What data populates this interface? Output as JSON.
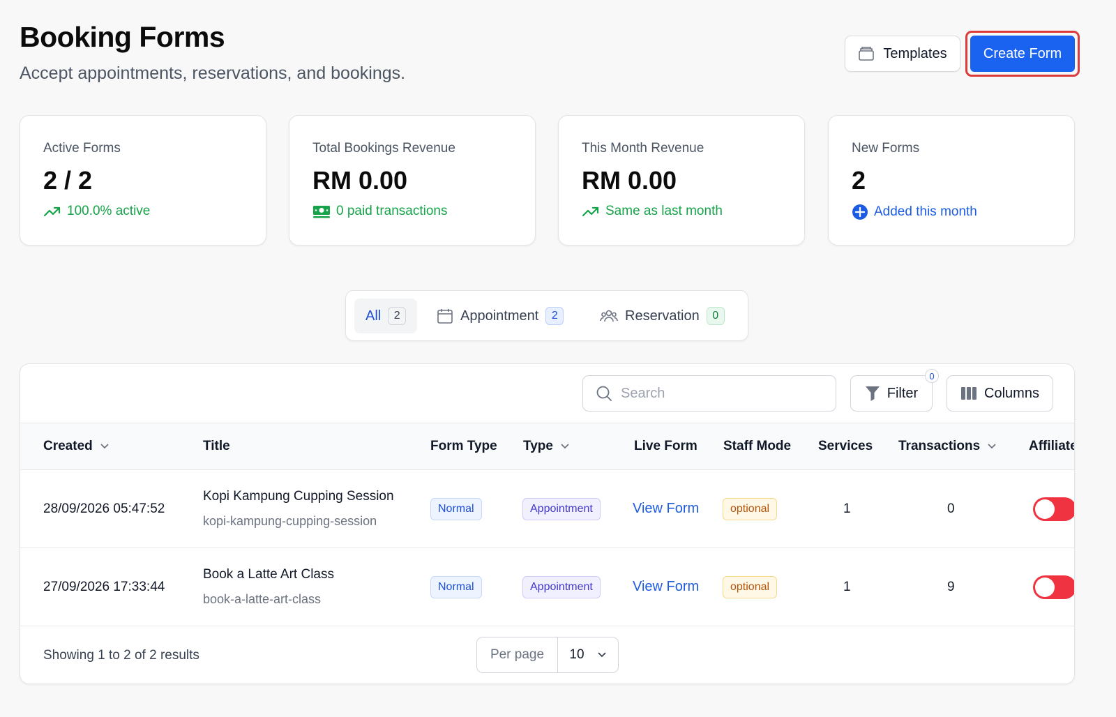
{
  "header": {
    "title": "Booking Forms",
    "subtitle": "Accept appointments, reservations, and bookings.",
    "templates_label": "Templates",
    "create_label": "Create Form"
  },
  "stats": [
    {
      "label": "Active Forms",
      "value": "2 / 2",
      "note": "100.0% active",
      "note_icon": "trending-up-icon",
      "note_color": "#16a34a"
    },
    {
      "label": "Total Bookings Revenue",
      "value": "RM 0.00",
      "note": "0 paid transactions",
      "note_icon": "cash-icon",
      "note_color": "#16a34a"
    },
    {
      "label": "This Month Revenue",
      "value": "RM 0.00",
      "note": "Same as last month",
      "note_icon": "trending-up-icon",
      "note_color": "#16a34a"
    },
    {
      "label": "New Forms",
      "value": "2",
      "note": "Added this month",
      "note_icon": "plus-circle-icon",
      "note_color": "#1d5be0"
    }
  ],
  "tabs": [
    {
      "label": "All",
      "count": "2",
      "active": true
    },
    {
      "label": "Appointment",
      "count": "2",
      "icon": "calendar-icon"
    },
    {
      "label": "Reservation",
      "count": "0",
      "icon": "users-icon"
    }
  ],
  "toolbar": {
    "search_placeholder": "Search",
    "filter_label": "Filter",
    "filter_count": "0",
    "columns_label": "Columns"
  },
  "columns": [
    "Created",
    "Title",
    "Form Type",
    "Type",
    "Live Form",
    "Staff Mode",
    "Services",
    "Transactions",
    "Affiliate"
  ],
  "rows": [
    {
      "created": "28/09/2026 05:47:52",
      "title": "Kopi Kampung Cupping Session",
      "slug": "kopi-kampung-cupping-session",
      "form_type": "Normal",
      "type": "Appointment",
      "live_form": "View Form",
      "staff_mode": "optional",
      "services": "1",
      "transactions": "0"
    },
    {
      "created": "27/09/2026 17:33:44",
      "title": "Book a Latte Art Class",
      "slug": "book-a-latte-art-class",
      "form_type": "Normal",
      "type": "Appointment",
      "live_form": "View Form",
      "staff_mode": "optional",
      "services": "1",
      "transactions": "9"
    }
  ],
  "footer": {
    "showing": "Showing 1 to 2 of 2 results",
    "per_page_label": "Per page",
    "per_page_value": "10"
  },
  "colors": {
    "primary": "#1a62f0",
    "danger_toggle": "#ef3340",
    "highlight": "#dc3b3b"
  }
}
